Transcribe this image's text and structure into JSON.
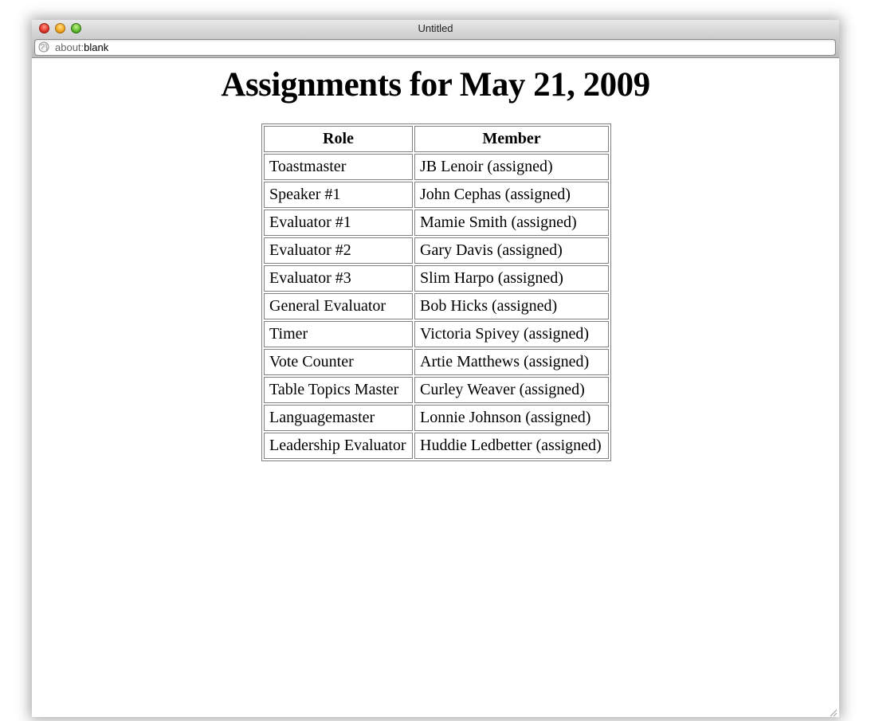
{
  "window": {
    "title": "Untitled",
    "url_scheme": "about:",
    "url_path": "blank"
  },
  "page": {
    "heading": "Assignments for May 21, 2009"
  },
  "table": {
    "headers": [
      "Role",
      "Member"
    ],
    "rows": [
      {
        "role": "Toastmaster",
        "member": "JB Lenoir (assigned)"
      },
      {
        "role": "Speaker #1",
        "member": "John Cephas (assigned)"
      },
      {
        "role": "Evaluator #1",
        "member": "Mamie Smith (assigned)"
      },
      {
        "role": "Evaluator #2",
        "member": "Gary Davis (assigned)"
      },
      {
        "role": "Evaluator #3",
        "member": "Slim Harpo (assigned)"
      },
      {
        "role": "General Evaluator",
        "member": "Bob Hicks (assigned)"
      },
      {
        "role": "Timer",
        "member": "Victoria Spivey (assigned)"
      },
      {
        "role": "Vote Counter",
        "member": "Artie Matthews (assigned)"
      },
      {
        "role": "Table Topics Master",
        "member": "Curley Weaver (assigned)"
      },
      {
        "role": "Languagemaster",
        "member": "Lonnie Johnson (assigned)"
      },
      {
        "role": "Leadership Evaluator",
        "member": "Huddie Ledbetter (assigned)"
      }
    ]
  },
  "icons": {
    "close": "close-button-icon",
    "minimize": "minimize-button-icon",
    "maximize": "zoom-button-icon",
    "url": "globe-icon",
    "resize": "resize-grip-icon"
  }
}
